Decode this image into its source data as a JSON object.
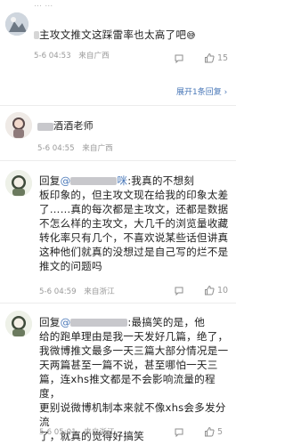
{
  "comment1": {
    "text_top_cut": "…  …",
    "text": "主攻文推文这踩雷率也太高了吧",
    "emoji": "😅",
    "date": "5-6 04:53",
    "location": "来自广西",
    "likes": "15",
    "expand_label": "展开1条回复"
  },
  "comment2": {
    "name_suffix": "酒酒老师",
    "date": "5-6 04:55",
    "location": "来自广西"
  },
  "comment3": {
    "reply_prefix": "回复",
    "name_suffix": "咪",
    "text_lines": [
      "回复@            咪:我真的不想刻",
      "板印象的，但主攻文现在给我的印象太差",
      "了……真的每次都是主攻文，还都是数据",
      "不怎么样的主攻文，大几千的浏览量收藏",
      "转化率只有几个，不喜欢说某些话但讲真",
      "这种他们就真的没想过是自己写的烂不是",
      "推文的问题吗"
    ],
    "date": "5-6 04:59",
    "location": "来自浙江",
    "likes": "10"
  },
  "comment4": {
    "text_lines": [
      "回复@               :最搞笑的是，他",
      "给的跑单理由是我一天发好几篇，绝了，",
      "我微博推文最多一天三篇大部分情况是一",
      "天两篇甚至一篇不说，甚至哪怕一天三",
      "篇，连xhs推文都是不会影响流量的程度，",
      "更别说微博机制本来就不像xhs会多发分流",
      "了，就真的觉得好搞笑"
    ],
    "date": "5-6 05:01",
    "location": "来自浙江",
    "likes": "5"
  }
}
